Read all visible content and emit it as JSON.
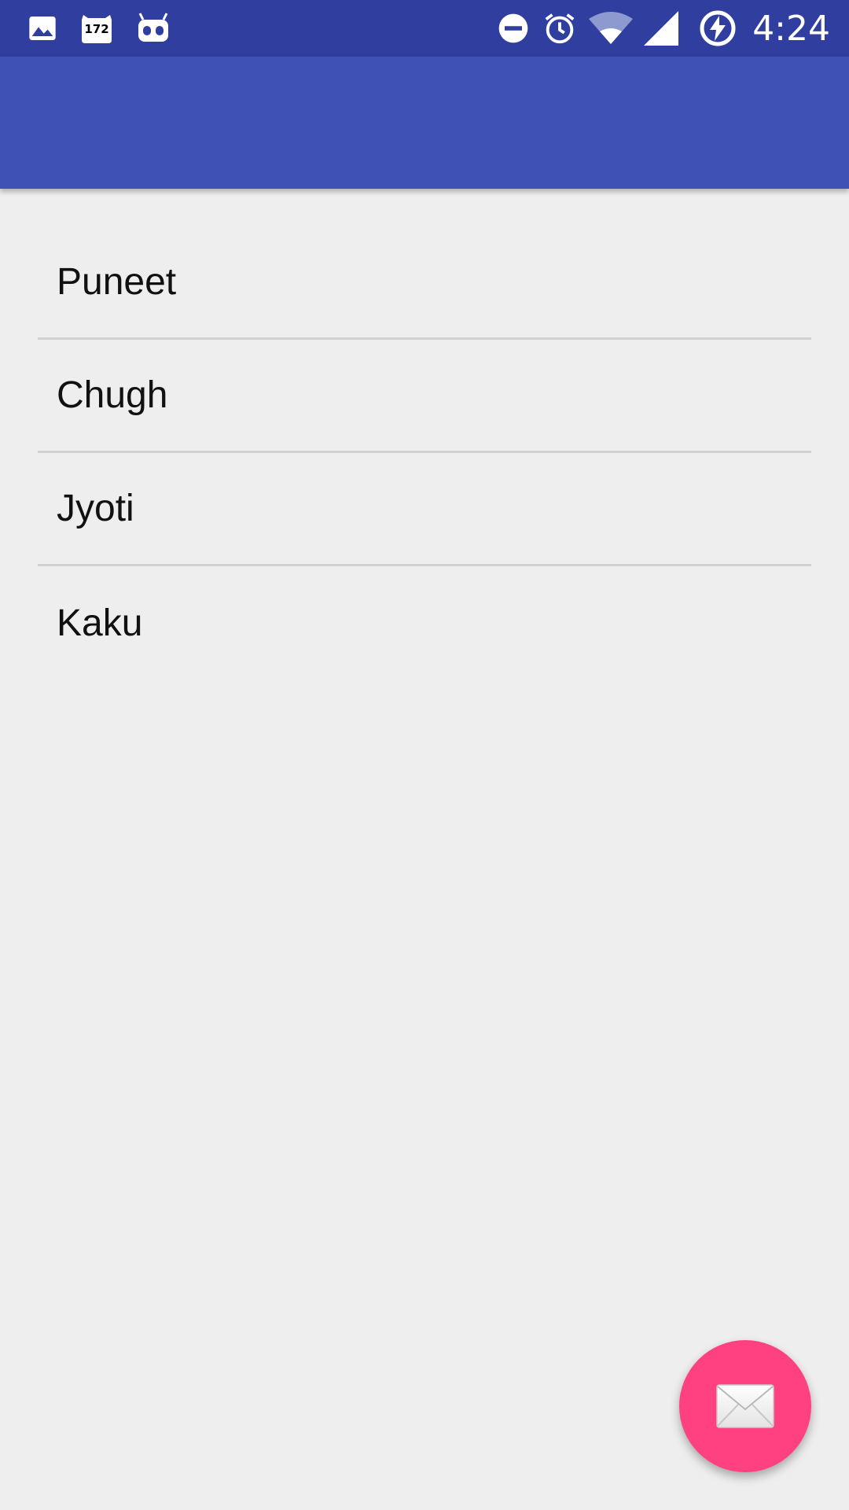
{
  "status_bar": {
    "background": "#303f9f",
    "time": "4:24",
    "left_icons": [
      "image-icon",
      "badge-icon",
      "android-icon"
    ],
    "badge_count": "172",
    "right_icons": [
      "do-not-disturb-icon",
      "alarm-icon",
      "wifi-icon",
      "signal-icon",
      "battery-charging-icon"
    ]
  },
  "app_bar": {
    "background": "#3f51b5",
    "title": ""
  },
  "list": {
    "items": [
      {
        "label": "Puneet"
      },
      {
        "label": "Chugh"
      },
      {
        "label": "Jyoti"
      },
      {
        "label": "Kaku"
      }
    ]
  },
  "fab": {
    "icon": "email-icon",
    "color": "#ff4081"
  }
}
